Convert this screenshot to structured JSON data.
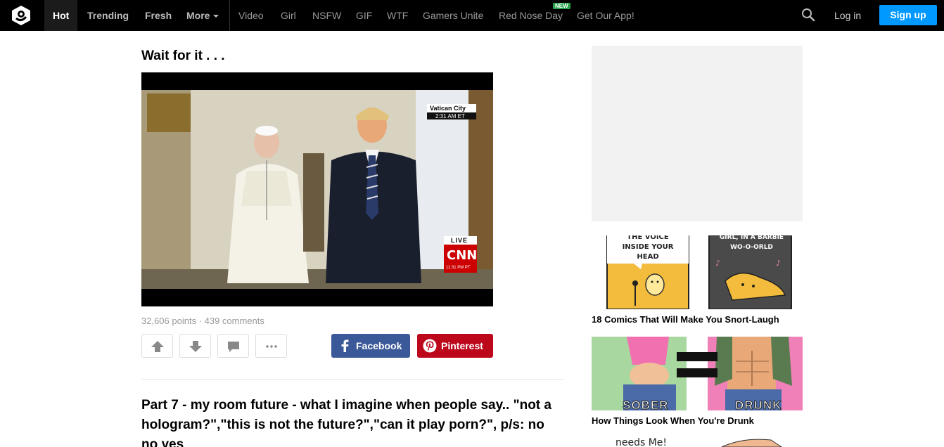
{
  "nav": {
    "logo": "9gag-logo-icon",
    "primary": [
      "Hot",
      "Trending",
      "Fresh",
      "More"
    ],
    "sections": [
      "Video",
      "Girl",
      "NSFW",
      "GIF",
      "WTF",
      "Gamers Unite",
      "Red Nose Day",
      "Get Our App!"
    ],
    "new_badge": "NEW",
    "search_icon": "search-icon",
    "login": "Log in",
    "signup": "Sign up"
  },
  "post": {
    "title": "Wait for it . . .",
    "video_overlay": {
      "location": "Vatican City",
      "time": "2:31 AM ET",
      "live": "LIVE",
      "network": "CNN",
      "network_time": "11:31 PM PT"
    },
    "meta": "32,606 points · 439 comments",
    "share_facebook": "Facebook",
    "share_pinterest": "Pinterest"
  },
  "next_post": {
    "title": "Part 7 - my room future - what I imagine when people say.. \"not a hologram?\",\"this is not the future?\",\"can it play porn?\", p/s: no no yes"
  },
  "sidebar": {
    "items": [
      {
        "caption": "18 Comics That Will Make You Snort-Laugh",
        "panel_left": "THE VOICE INSIDE YOUR HEAD",
        "panel_right": "GIRL, IN A BARBIE WO-O-ORLD"
      },
      {
        "caption": "How Things Look When You're Drunk",
        "label_left": "SOBER",
        "label_right": "DRUNK"
      },
      {
        "caption": "",
        "snippet": "needs Me!"
      }
    ]
  },
  "colors": {
    "topbar": "#000000",
    "signup": "#0099ff",
    "facebook": "#3b5998",
    "pinterest": "#bd081c",
    "new_badge": "#2aa34a"
  }
}
